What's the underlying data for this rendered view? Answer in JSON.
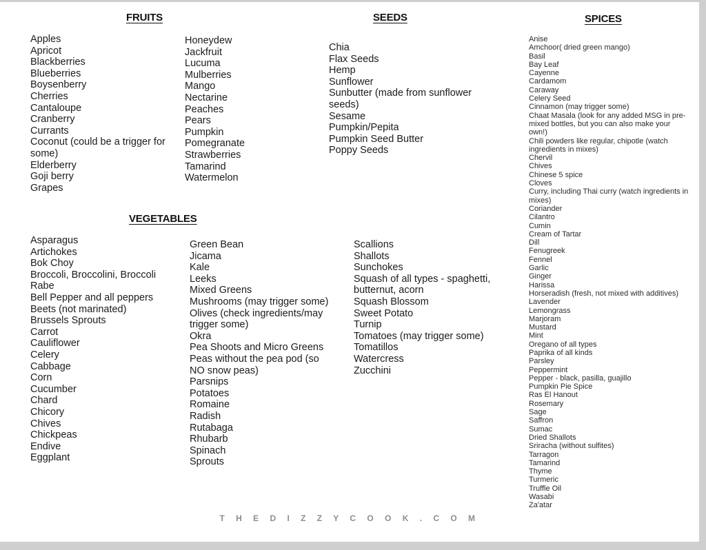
{
  "watermark": "T H E D I Z Z Y C O O K . C O M",
  "colors": {
    "text": "#1b1b1b",
    "heading": "#111111",
    "watermark": "#8d8d8d",
    "page": "#ffffff",
    "backdrop": "#cfcfcf"
  },
  "sections": {
    "fruits": {
      "title": "FRUITS",
      "column_1": [
        "Apples",
        "Apricot",
        "Blackberries",
        "Blueberries",
        "Boysenberry",
        "Cherries",
        "Cantaloupe",
        "Cranberry",
        "Currants",
        "Coconut (could be a trigger for some)",
        "Elderberry",
        "Goji berry",
        "Grapes"
      ],
      "column_2": [
        "Honeydew",
        "Jackfruit",
        "Lucuma",
        "Mulberries",
        "Mango",
        "Nectarine",
        "Peaches",
        "Pears",
        "Pumpkin",
        "Pomegranate",
        "Strawberries",
        "Tamarind",
        "Watermelon"
      ]
    },
    "seeds": {
      "title": "SEEDS",
      "column_1": [
        "Chia",
        "Flax Seeds",
        "Hemp",
        "Sunflower",
        "Sunbutter (made from sunflower seeds)",
        "Sesame",
        "Pumpkin/Pepita",
        "Pumpkin Seed Butter",
        "Poppy Seeds"
      ]
    },
    "spices": {
      "title": "SPICES",
      "column_1": [
        "Anise",
        "Amchoor( dried green mango)",
        "Basil",
        "Bay Leaf",
        "Cayenne",
        "Cardamom",
        "Caraway",
        "Celery Seed",
        "Cinnamon (may trigger some)",
        "Chaat Masala (look for any added MSG in pre-mixed bottles, but you can also make your own!)",
        "Chili powders like regular, chipotle (watch ingredients in mixes)",
        "Chervil",
        "Chives",
        "Chinese 5 spice",
        "Cloves",
        "Curry, including Thai curry (watch ingredients in mixes)",
        "Coriander",
        "Cilantro",
        "Cumin",
        "Cream of Tartar",
        "Dill",
        "Fenugreek",
        "Fennel",
        "Garlic",
        "Ginger",
        "Harissa",
        "Horseradish (fresh, not mixed with additives)",
        "Lavender",
        "Lemongrass",
        "Marjoram",
        "Mustard",
        "Mint",
        "Oregano of all types",
        "Paprika of all kinds",
        "Parsley",
        "Peppermint",
        "Pepper - black, pasilla, guajillo",
        "Pumpkin Pie Spice",
        "Ras El Hanout",
        "Rosemary",
        "Sage",
        "Saffron",
        "Sumac",
        "Dried Shallots",
        "Sriracha (without sulfites)",
        "Tarragon",
        "Tamarind",
        "Thyme",
        "Turmeric",
        "Truffle Oil",
        "Wasabi",
        "Za'atar"
      ]
    },
    "vegetables": {
      "title": "VEGETABLES",
      "column_1": [
        "Asparagus",
        "Artichokes",
        "Bok Choy",
        "Broccoli, Broccolini, Broccoli Rabe",
        "Bell Pepper and all peppers",
        "Beets (not marinated)",
        "Brussels Sprouts",
        "Carrot",
        "Cauliflower",
        "Celery",
        "Cabbage",
        "Corn",
        "Cucumber",
        "Chard",
        "Chicory",
        "Chives",
        "Chickpeas",
        "Endive",
        "Eggplant"
      ],
      "column_2": [
        "Green Bean",
        "Jicama",
        "Kale",
        "Leeks",
        "Mixed Greens",
        "Mushrooms (may trigger some)",
        "Olives (check ingredients/may trigger some)",
        "Okra",
        "Pea Shoots and Micro Greens",
        "Peas without the pea pod (so NO snow peas)",
        "Parsnips",
        "Potatoes",
        "Romaine",
        "Radish",
        "Rutabaga",
        "Rhubarb",
        "Spinach",
        "Sprouts"
      ],
      "column_3": [
        "Scallions",
        "Shallots",
        "Sunchokes",
        "Squash of all types - spaghetti, butternut, acorn",
        "Squash Blossom",
        "Sweet Potato",
        "Turnip",
        "Tomatoes (may trigger some)",
        "Tomatillos",
        "Watercress",
        "Zucchini"
      ]
    }
  }
}
